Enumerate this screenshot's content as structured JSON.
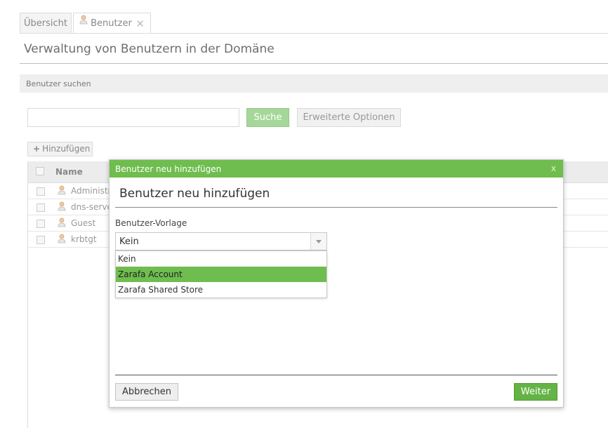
{
  "tabs": [
    {
      "label": "Übersicht"
    },
    {
      "label": "Benutzer",
      "icon": "user-icon",
      "close_icon": "close-icon"
    }
  ],
  "page": {
    "title": "Verwaltung von Benutzern in der Domäne"
  },
  "search": {
    "panel_title": "Benutzer suchen",
    "input_value": "",
    "search_button": "Suche",
    "advanced_button": "Erweiterte Optionen"
  },
  "grid": {
    "add_button": "Hinzufügen",
    "add_icon": "plus-icon",
    "column_name": "Name",
    "rows": [
      {
        "name": "Administrator"
      },
      {
        "name": "dns-server"
      },
      {
        "name": "Guest"
      },
      {
        "name": "krbtgt"
      }
    ]
  },
  "dialog": {
    "titlebar": "Benutzer neu hinzufügen",
    "close_glyph": "x",
    "heading": "Benutzer neu hinzufügen",
    "template_label": "Benutzer-Vorlage",
    "template_value": "Kein",
    "options": [
      "Kein",
      "Zarafa Account",
      "Zarafa Shared Store"
    ],
    "highlighted_option": "Zarafa Account",
    "cancel_button": "Abbrechen",
    "next_button": "Weiter"
  },
  "colors": {
    "accent_green": "#6fbd4e",
    "button_green": "#64b445",
    "disabled_green": "#a6d79a"
  }
}
